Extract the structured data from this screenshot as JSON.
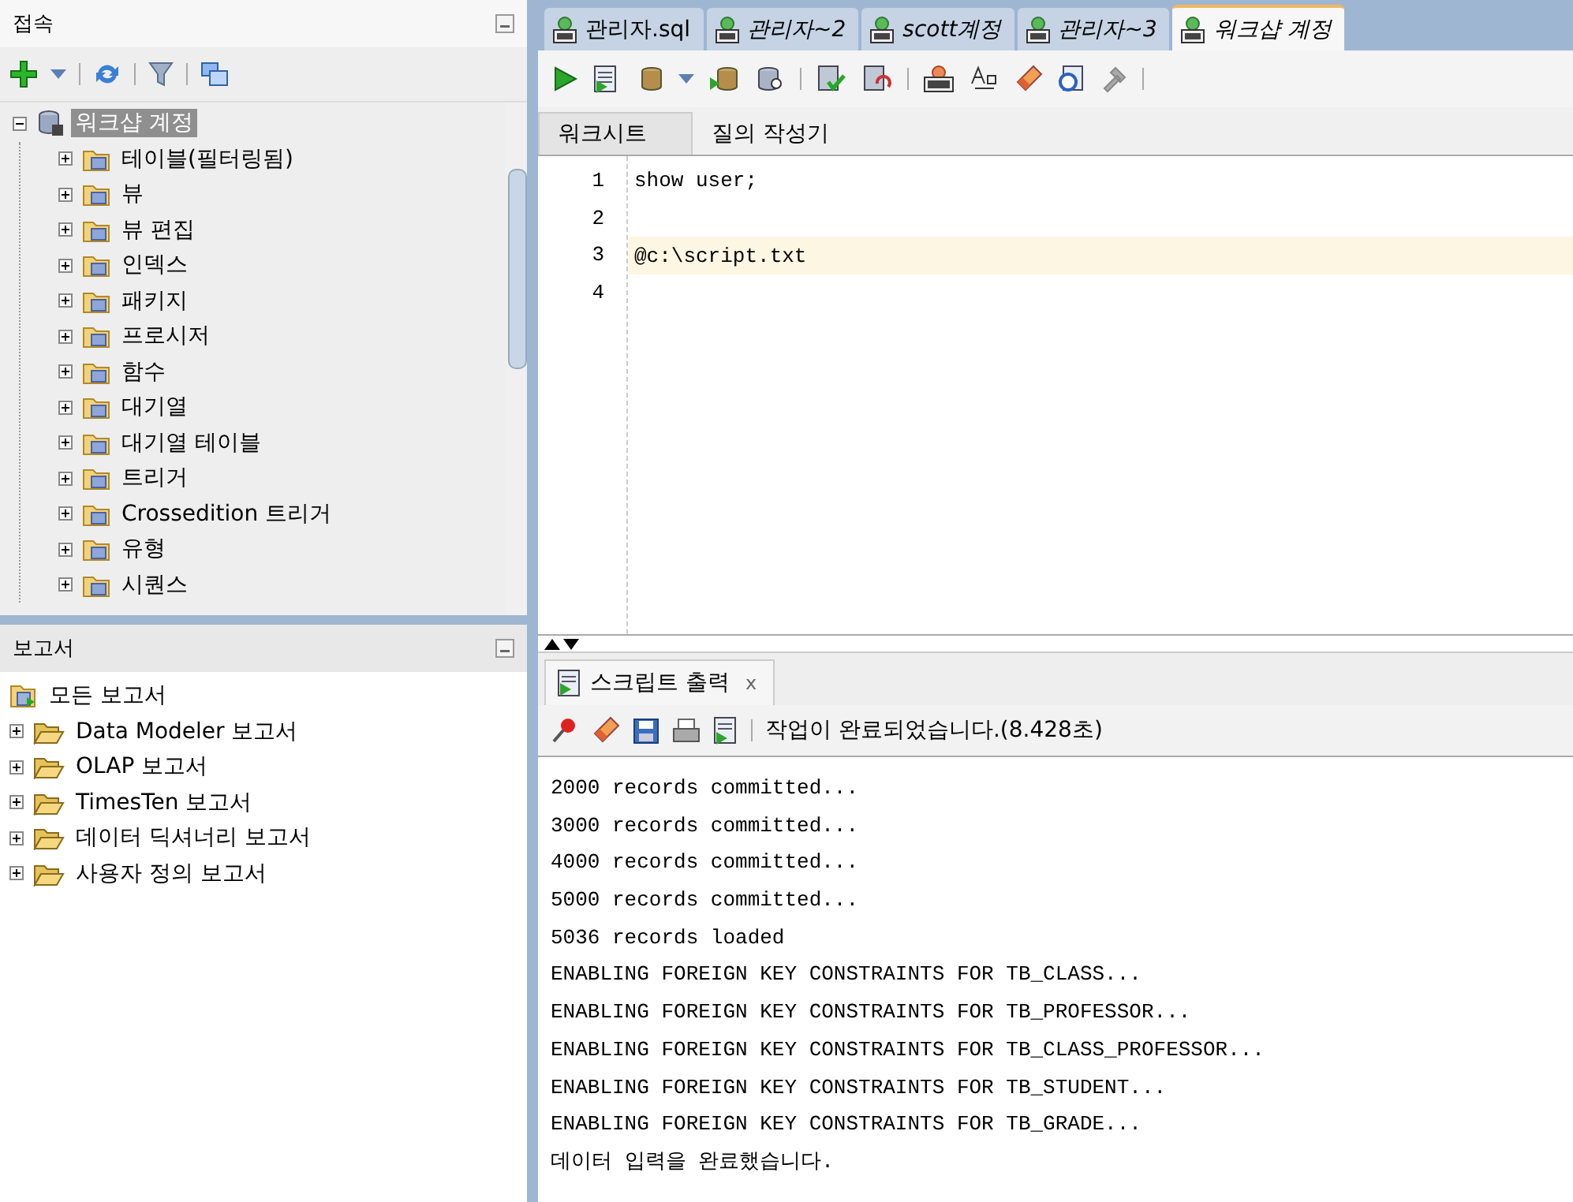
{
  "connections_panel": {
    "title": "접속",
    "tree": {
      "label": "워크샵 계정",
      "expanded": true,
      "selected": true,
      "children": [
        {
          "label": "테이블(필터링됨)",
          "expanded": false
        },
        {
          "label": "뷰",
          "expanded": false
        },
        {
          "label": "뷰 편집",
          "expanded": false
        },
        {
          "label": "인덱스",
          "expanded": false
        },
        {
          "label": "패키지",
          "expanded": false
        },
        {
          "label": "프로시저",
          "expanded": false
        },
        {
          "label": "함수",
          "expanded": false
        },
        {
          "label": "대기열",
          "expanded": false
        },
        {
          "label": "대기열 테이블",
          "expanded": false
        },
        {
          "label": "트리거",
          "expanded": false
        },
        {
          "label": "Crossedition 트리거",
          "expanded": false
        },
        {
          "label": "유형",
          "expanded": false
        },
        {
          "label": "시퀀스",
          "expanded": false
        }
      ]
    }
  },
  "reports_panel": {
    "title": "보고서",
    "root": "모든 보고서",
    "items": [
      {
        "label": "Data Modeler 보고서",
        "expanded": false
      },
      {
        "label": "OLAP 보고서",
        "expanded": false
      },
      {
        "label": "TimesTen 보고서",
        "expanded": false
      },
      {
        "label": "데이터 딕셔너리 보고서",
        "expanded": false
      },
      {
        "label": "사용자 정의 보고서",
        "expanded": false
      }
    ]
  },
  "editor_tabs": [
    {
      "label": "관리자.sql",
      "selected": false,
      "italic": false
    },
    {
      "label": "관리자~2",
      "selected": false,
      "italic": true
    },
    {
      "label": "scott계정",
      "selected": false,
      "italic": true
    },
    {
      "label": "관리자~3",
      "selected": false,
      "italic": true
    },
    {
      "label": "워크샵 계정",
      "selected": true,
      "italic": true
    }
  ],
  "sub_tabs": [
    {
      "label": "워크시트",
      "selected": true
    },
    {
      "label": "질의 작성기",
      "selected": false
    }
  ],
  "editor_lines": [
    {
      "number": "1",
      "text": "show user;",
      "current": false
    },
    {
      "number": "2",
      "current": false
    },
    {
      "number": "3",
      "text": "@c:\\script.txt",
      "current": true
    },
    {
      "number": "4",
      "current": false
    }
  ],
  "output_panel": {
    "tab": "스크립트 출력",
    "tab_close": "x",
    "status": "작업이 완료되었습니다.(8.428초)",
    "lines": [
      "2000 records committed...",
      "3000 records committed...",
      "4000 records committed...",
      "5000 records committed...",
      "5036 records loaded",
      "ENABLING FOREIGN KEY CONSTRAINTS FOR TB_CLASS...",
      "ENABLING FOREIGN KEY CONSTRAINTS FOR TB_PROFESSOR...",
      "ENABLING FOREIGN KEY CONSTRAINTS FOR TB_CLASS_PROFESSOR...",
      "ENABLING FOREIGN KEY CONSTRAINTS FOR TB_STUDENT...",
      "ENABLING FOREIGN KEY CONSTRAINTS FOR TB_GRADE...",
      "데이터 입력을 완료했습니다."
    ]
  }
}
